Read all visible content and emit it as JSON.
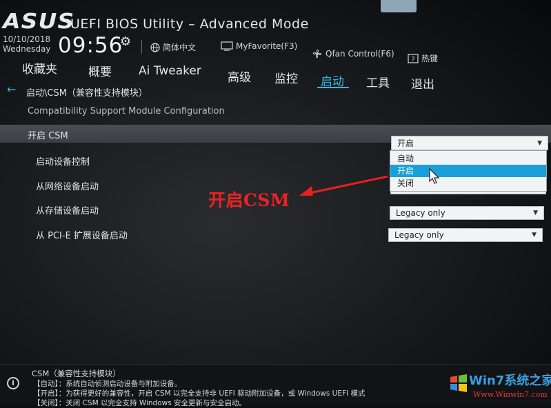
{
  "header": {
    "brand": "ASUS",
    "title": "UEFI BIOS Utility – Advanced Mode",
    "date": "10/10/2018",
    "weekday": "Wednesday",
    "time": "09:56",
    "language": "简体中文",
    "favorite": "MyFavorite(F3)",
    "qfan": "Qfan Control(F6)",
    "hotkeys": "热键"
  },
  "tabs": [
    "收藏夹",
    "概要",
    "Ai Tweaker",
    "高级",
    "监控",
    "启动",
    "工具",
    "退出"
  ],
  "active_tab": "启动",
  "breadcrumb": "启动\\CSM（兼容性支持模块）",
  "subtitle": "Compatibility Support Module Configuration",
  "settings": [
    {
      "label": "开启 CSM",
      "value": "开启"
    },
    {
      "label": "启动设备控制",
      "value": ""
    },
    {
      "label": "从网络设备启动",
      "value": ""
    },
    {
      "label": "从存储设备启动",
      "value": "Legacy only"
    },
    {
      "label": "从 PCI-E 扩展设备启动",
      "value": "Legacy only"
    }
  ],
  "dropdown_options": [
    "自动",
    "开启",
    "关闭"
  ],
  "dropdown_highlighted": "开启",
  "annotation": "开启CSM",
  "help": {
    "title": "CSM（兼容性支持模块）",
    "lines": [
      "【自动】：系统自动侦测启动设备与附加设备。",
      "【开启】：为获得更好的兼容性，开启 CSM 以完全支持非 UEFI 驱动附加设备，或 Windows UEFI 模式",
      "【关闭】：关闭 CSM 以完全支持 Windows 安全更新与安全启动。"
    ]
  },
  "watermark": {
    "brand": "Win7系统之家",
    "url": "Www.Winwin7.com"
  },
  "colors": {
    "accent": "#2fb9e6",
    "highlight": "#1aa0d8",
    "annotation": "#ee2222"
  }
}
